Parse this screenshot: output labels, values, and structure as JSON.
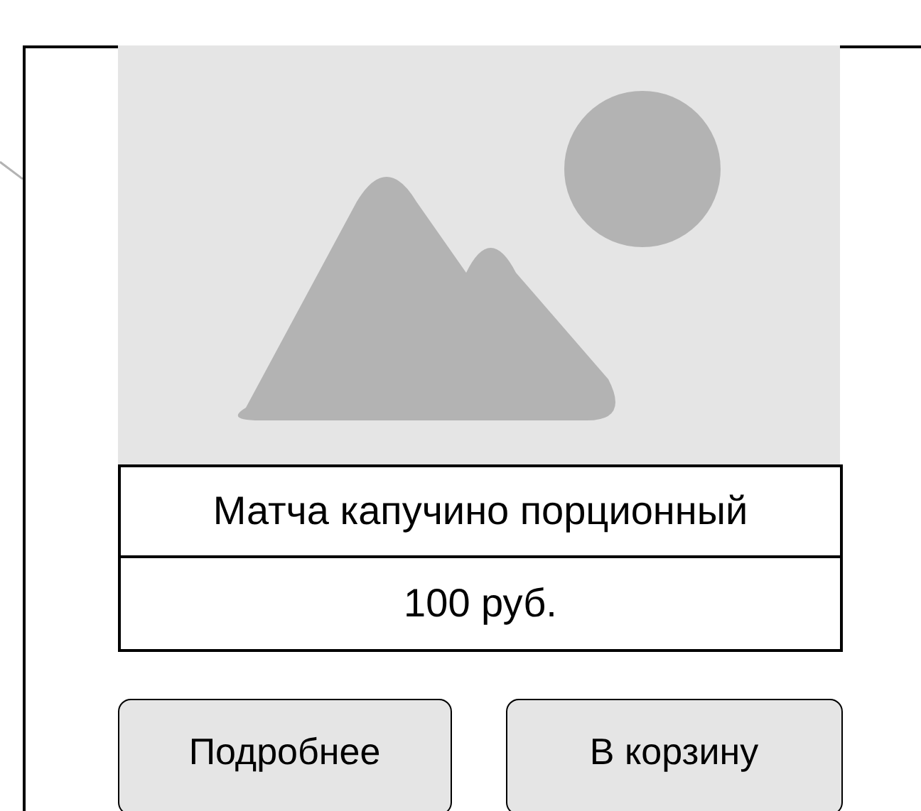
{
  "product": {
    "title": "Матча капучино порционный",
    "price": "100 руб."
  },
  "buttons": [
    {
      "label": "Подробнее"
    },
    {
      "label": "В корзину"
    }
  ]
}
